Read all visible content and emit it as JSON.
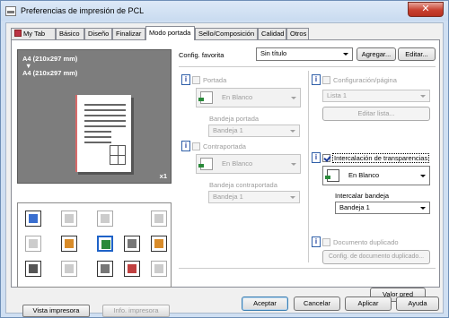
{
  "window": {
    "title": "Preferencias de impresión de PCL",
    "close_glyph": "✕"
  },
  "tabs": [
    {
      "label": "My Tab",
      "icon": "my-tab-icon"
    },
    {
      "label": "Básico"
    },
    {
      "label": "Diseño"
    },
    {
      "label": "Finalizar"
    },
    {
      "label": "Modo portada",
      "active": true
    },
    {
      "label": "Sello/Composición"
    },
    {
      "label": "Calidad"
    },
    {
      "label": "Otros"
    }
  ],
  "preview": {
    "paper_line1": "A4 (210x297 mm)",
    "arrow": "▼",
    "paper_line2": "A4 (210x297 mm)",
    "copies": "x1"
  },
  "preview_buttons": {
    "printer_view": "Vista impresora",
    "printer_info": "Info. impresora"
  },
  "favorites": {
    "label": "Config. favorita",
    "value": "Sin título",
    "add_button": "Agregar...",
    "edit_button": "Editar..."
  },
  "front_cover": {
    "label": "Portada",
    "mode": "En Blanco",
    "tray_label": "Bandeja portada",
    "tray_value": "Bandeja 1"
  },
  "back_cover": {
    "label": "Contraportada",
    "mode": "En Blanco",
    "tray_label": "Bandeja contraportada",
    "tray_value": "Bandeja 1"
  },
  "page_setting": {
    "label": "Configuración/página",
    "list_value": "Lista 1",
    "edit_list_button": "Editar lista..."
  },
  "transparency": {
    "label": "Intercalación de transparencias",
    "mode": "En Blanco",
    "tray_label": "Intercalar bandeja",
    "tray_value": "Bandeja 1"
  },
  "duplicate_doc": {
    "label": "Documento duplicado",
    "settings_button": "Config. de documento duplicado..."
  },
  "default_button": "Valor pred",
  "dialog_buttons": {
    "ok": "Aceptar",
    "cancel": "Cancelar",
    "apply": "Aplicar",
    "help": "Ayuda"
  },
  "info_glyph": "i",
  "colors": {
    "accent": "#1e62c8",
    "close": "#c8402f"
  }
}
